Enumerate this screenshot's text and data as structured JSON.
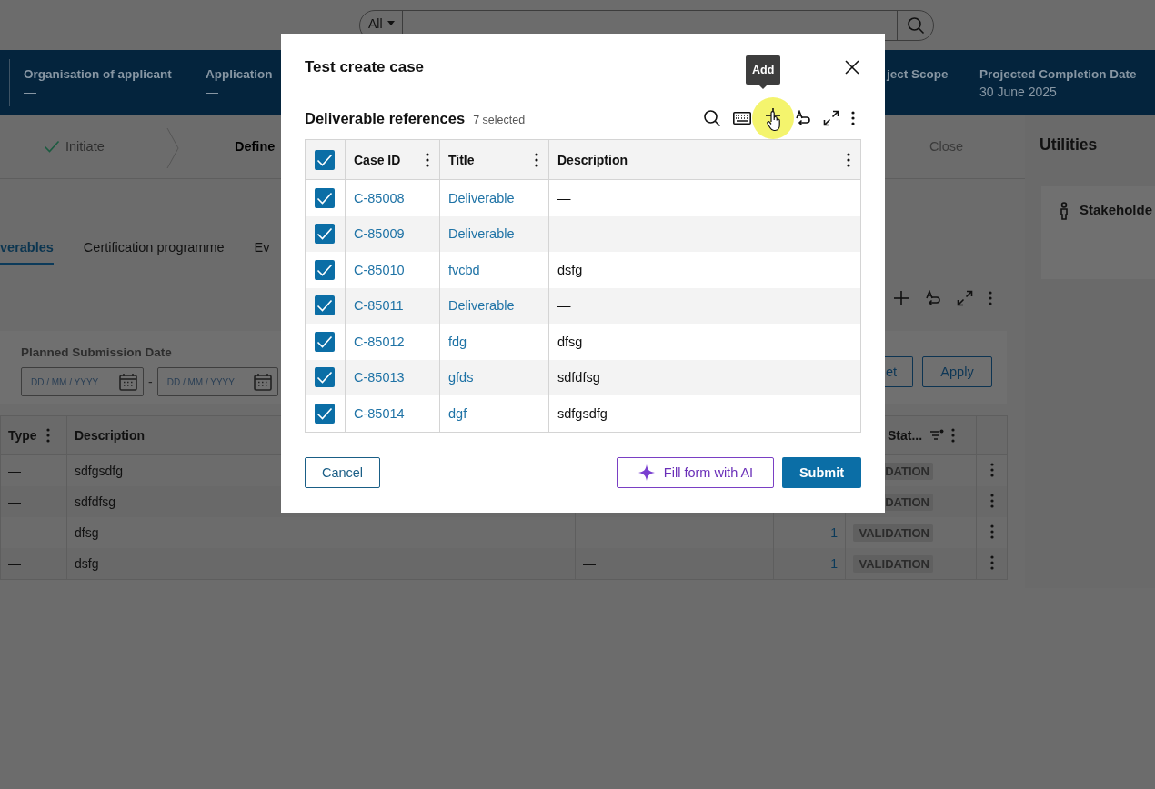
{
  "search": {
    "scope": "All"
  },
  "header_fields": [
    {
      "label": "Organisation of applicant",
      "value": "—"
    },
    {
      "label": "Application",
      "value": "—"
    },
    {
      "label": "ject Scope"
    },
    {
      "label": "Projected Completion Date",
      "value": "30 June 2025"
    }
  ],
  "stages": [
    {
      "label": "Initiate",
      "done": true,
      "selected": false
    },
    {
      "label": "Define",
      "done": false,
      "selected": true
    },
    {
      "label": "Close",
      "done": false,
      "selected": false
    }
  ],
  "utilities": {
    "title": "Utilities",
    "items": [
      {
        "label": "Stakeholde"
      }
    ]
  },
  "tabs": [
    {
      "label": "verables",
      "selected": true
    },
    {
      "label": "Certification programme",
      "selected": false
    },
    {
      "label": "Ev",
      "selected": false
    }
  ],
  "filters": {
    "label": "Planned Submission Date",
    "from": {
      "placeholder": "DD / MM / YYYY"
    },
    "separator": "-",
    "to": {
      "placeholder": "DD / MM / YYYY"
    },
    "buttons": [
      "et",
      "Apply"
    ]
  },
  "table": {
    "columns": [
      "Type",
      "Description",
      "Stat..."
    ],
    "rows": [
      {
        "type": "—",
        "description": "sdfgsdfg",
        "status": "DATION"
      },
      {
        "type": "—",
        "description": "sdfdfsg",
        "status": "DATION"
      },
      {
        "type": "—",
        "description": "dfsg",
        "column_3": "—",
        "column_4": "1",
        "status": "VALIDATION"
      },
      {
        "type": "—",
        "description": "dsfg",
        "column_3": "—",
        "column_4": "1",
        "status": "VALIDATION"
      }
    ]
  },
  "modal": {
    "title": "Test create case",
    "section": "Deliverable references",
    "selection_count": "7 selected",
    "tooltip": "Add",
    "all_selected": true,
    "columns": [
      "Case ID",
      "Title",
      "Description"
    ],
    "rows": [
      {
        "selected": true,
        "case_id": "C-85008",
        "title": "Deliverable",
        "description": "—"
      },
      {
        "selected": true,
        "case_id": "C-85009",
        "title": "Deliverable",
        "description": "—"
      },
      {
        "selected": true,
        "case_id": "C-85010",
        "title": "fvcbd",
        "description": "dsfg"
      },
      {
        "selected": true,
        "case_id": "C-85011",
        "title": "Deliverable",
        "description": "—"
      },
      {
        "selected": true,
        "case_id": "C-85012",
        "title": "fdg",
        "description": "dfsg"
      },
      {
        "selected": true,
        "case_id": "C-85013",
        "title": "gfds",
        "description": "sdfdfsg"
      },
      {
        "selected": true,
        "case_id": "C-85014",
        "title": "dgf",
        "description": "sdfgsdfg"
      }
    ],
    "buttons": {
      "cancel": "Cancel",
      "ai": "Fill form with AI",
      "submit": "Submit"
    }
  }
}
